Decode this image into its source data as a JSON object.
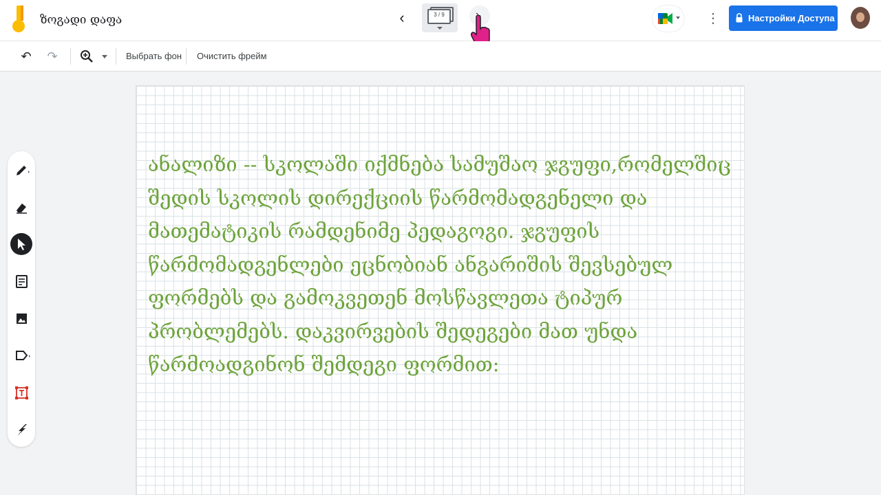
{
  "app": {
    "title": "ზოგადი დაფა",
    "frame_counter": "3 / 9",
    "share_label": "Настройки Доступа"
  },
  "toolbar": {
    "icons": [
      "undo-icon",
      "redo-icon",
      "zoom-icon",
      "dropdown-icon"
    ],
    "set_background": "Выбрать фон",
    "clear_frame": "Очистить фрейм"
  },
  "side_tools": [
    "pen-icon",
    "eraser-icon",
    "select-icon",
    "sticky-note-icon",
    "image-icon",
    "shape-icon",
    "text-box-icon",
    "laser-icon"
  ],
  "canvas": {
    "lines": [
      "ანალიზი -- სკოლაში იქმნება სამუშაო ჯგუფი,რომელშიც",
      "შედის სკოლის დირექციის წარმომადგენელი და",
      "მათემატიკის რამდენიმე პედაგოგი. ჯგუფის",
      "წარმომადგენლები ეცნობიან ანგარიშის შევსებულ",
      "ფორმებს და გამოკვეთენ მოსწავლეთა ტიპურ",
      "პრობლემებს. დაკვირვების შედეგები მათ უნდა",
      "წარმოადგინონ შემდეგი ფორმით:"
    ]
  },
  "colors": {
    "accent": "#1a73e8",
    "ink": "#6da33b",
    "cursor": "#e0218a"
  }
}
